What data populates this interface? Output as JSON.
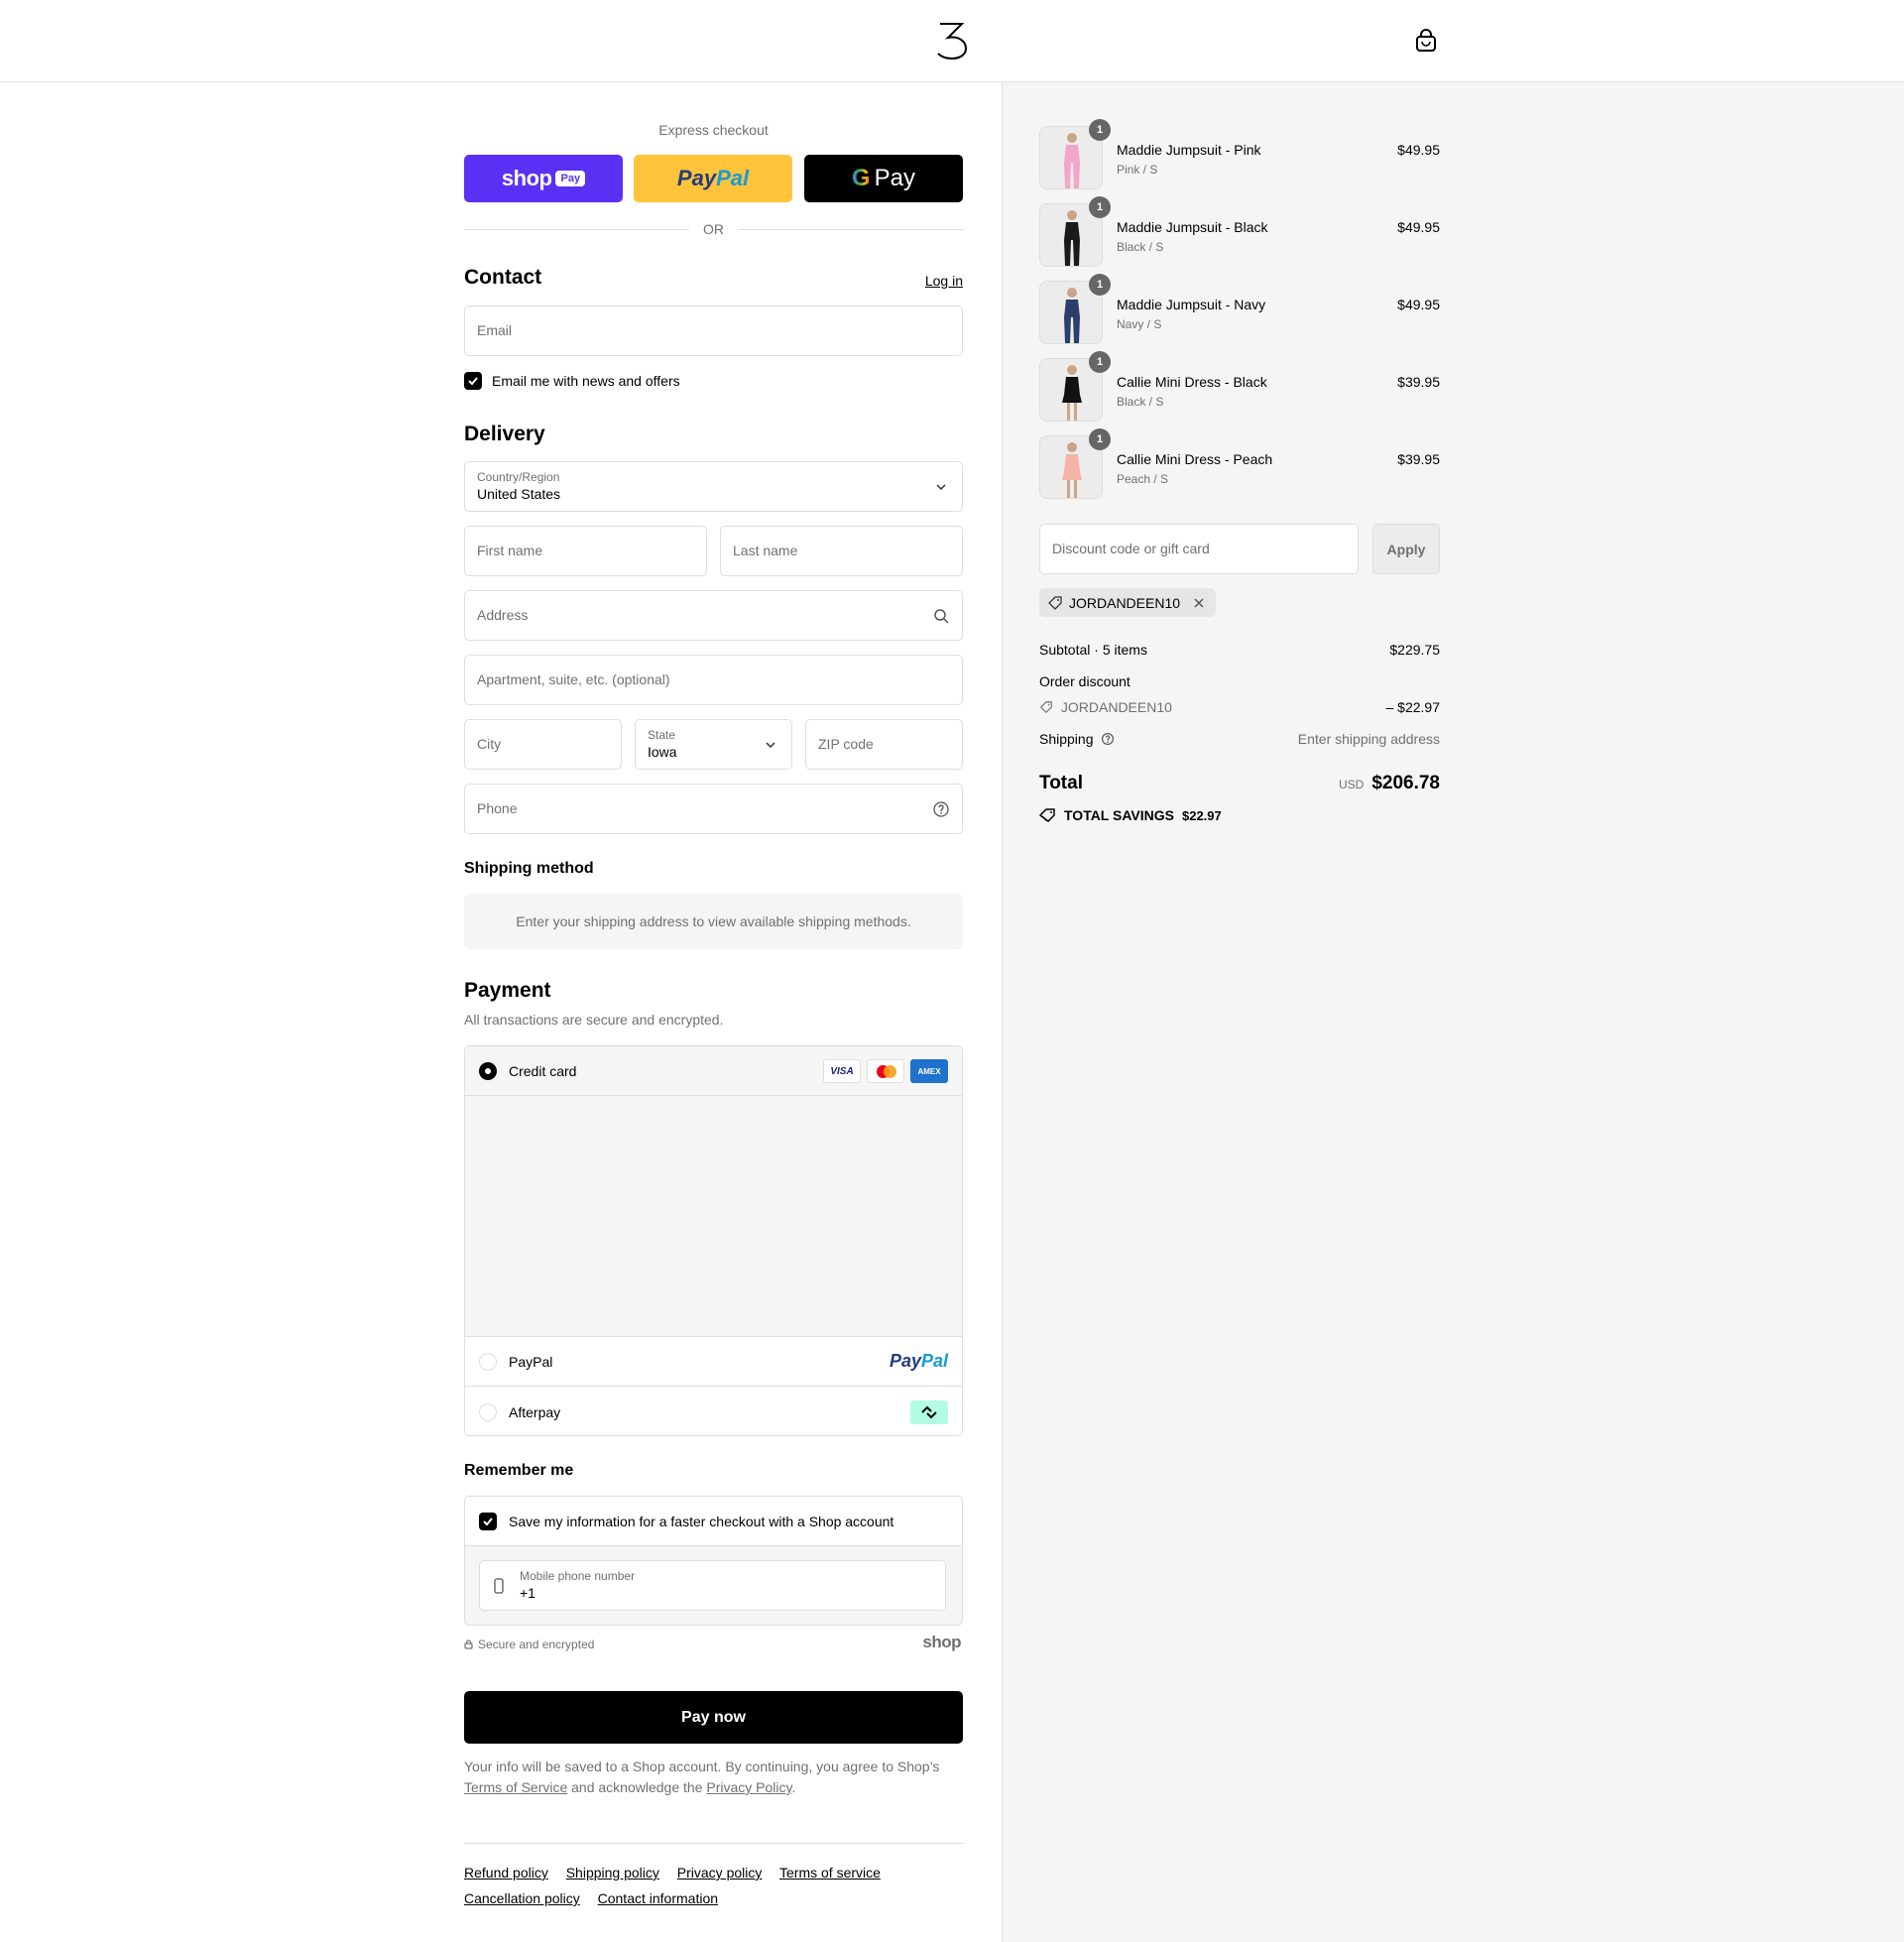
{
  "express": {
    "title": "Express checkout",
    "or": "OR",
    "shop_pay": {
      "word": "shop",
      "badge": "Pay"
    },
    "paypal": {
      "pay": "Pay",
      "pal": "Pal"
    },
    "gpay": {
      "g": "G",
      "pay": "Pay"
    }
  },
  "contact": {
    "title": "Contact",
    "login": "Log in",
    "email_placeholder": "Email",
    "news_label": "Email me with news and offers"
  },
  "delivery": {
    "title": "Delivery",
    "country_label": "Country/Region",
    "country_value": "United States",
    "first_name": "First name",
    "last_name": "Last name",
    "address": "Address",
    "apartment": "Apartment, suite, etc. (optional)",
    "city": "City",
    "state_label": "State",
    "state_value": "Iowa",
    "zip": "ZIP code",
    "phone": "Phone"
  },
  "shipping_method": {
    "title": "Shipping method",
    "message": "Enter your shipping address to view available shipping methods."
  },
  "payment": {
    "title": "Payment",
    "subtitle": "All transactions are secure and encrypted.",
    "credit_card": "Credit card",
    "paypal": "PayPal",
    "afterpay": "Afterpay",
    "card_brands": [
      "VISA",
      "mastercard",
      "AMEX"
    ],
    "paypal_logo": {
      "pay": "Pay",
      "pal": "Pal"
    }
  },
  "remember": {
    "title": "Remember me",
    "save_label": "Save my information for a faster checkout with a Shop account",
    "mobile_label": "Mobile phone number",
    "mobile_value": "+1",
    "secure": "Secure and encrypted",
    "shop_logo": "shop"
  },
  "pay_now": "Pay now",
  "legal": {
    "text1": "Your info will be saved to a Shop account. By continuing, you agree to Shop’s",
    "tos": "Terms of Service",
    "text2": "and acknowledge the",
    "privacy": "Privacy Policy",
    "end": "."
  },
  "footer_links": [
    "Refund policy",
    "Shipping policy",
    "Privacy policy",
    "Terms of service",
    "Cancellation policy",
    "Contact information"
  ],
  "cart": {
    "items": [
      {
        "name": "Maddie Jumpsuit - Pink",
        "variant": "Pink / S",
        "price": "$49.95",
        "qty": "1",
        "color": "#f3a6c8"
      },
      {
        "name": "Maddie Jumpsuit - Black",
        "variant": "Black / S",
        "price": "$49.95",
        "qty": "1",
        "color": "#1a1a1a"
      },
      {
        "name": "Maddie Jumpsuit - Navy",
        "variant": "Navy / S",
        "price": "$49.95",
        "qty": "1",
        "color": "#2a3f6b"
      },
      {
        "name": "Callie Mini Dress - Black",
        "variant": "Black / S",
        "price": "$39.95",
        "qty": "1",
        "color": "#111111"
      },
      {
        "name": "Callie Mini Dress - Peach",
        "variant": "Peach / S",
        "price": "$39.95",
        "qty": "1",
        "color": "#f3b3a6"
      }
    ],
    "discount_placeholder": "Discount code or gift card",
    "apply": "Apply",
    "code": "JORDANDEEN10",
    "subtotal_label": "Subtotal · 5 items",
    "subtotal": "$229.75",
    "order_discount": "Order discount",
    "discount_code": "JORDANDEEN10",
    "discount_value": "– $22.97",
    "shipping_label": "Shipping",
    "shipping_value": "Enter shipping address",
    "total_label": "Total",
    "currency": "USD",
    "total": "$206.78",
    "savings_label": "TOTAL SAVINGS",
    "savings": "$22.97"
  }
}
